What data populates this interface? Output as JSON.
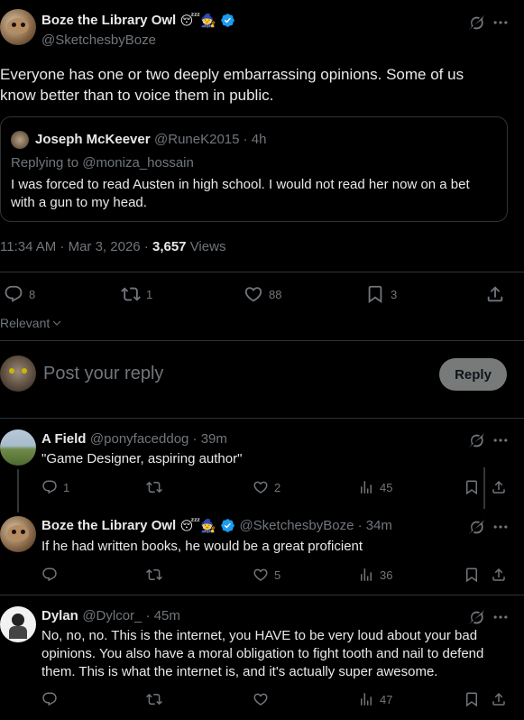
{
  "main_post": {
    "author_name": "Boze the Library Owl",
    "author_emojis": "😴🧙",
    "author_handle": "@SketchesbyBoze",
    "text_line1": "Everyone has one or two deeply embarrassing opinions. Some of us",
    "text_line2": "know better than to voice them in public.",
    "timestamp": "11:34 AM · Mar 3, 2026 · ",
    "views_count": "3,657",
    "views_label": " Views",
    "replies": "8",
    "reposts": "1",
    "likes": "88",
    "bookmarks": "3"
  },
  "quoted_post": {
    "author_name": "Joseph McKeever",
    "author_handle": "@RuneK2015 · 4h",
    "replying_to": "Replying to @moniza_hossain",
    "text_line1": "I was forced to read Austen in high school. I would not read her now on a bet",
    "text_line2": "with a gun to my head."
  },
  "sort_label": "Relevant",
  "reply_box": {
    "placeholder": "Post your reply",
    "button_label": "Reply"
  },
  "replies": [
    {
      "author_name": "A Field",
      "author_handle": "@ponyfaceddog · 39m",
      "text": "\"Game Designer, aspiring author\"",
      "replies": "1",
      "reposts": "",
      "likes": "2",
      "views": "45"
    },
    {
      "author_name": "Boze the Library Owl",
      "author_emojis": "😴🧙",
      "author_handle": "@SketchesbyBoze · 34m",
      "text": "If he had written books, he would be a great proficient",
      "replies": "",
      "reposts": "",
      "likes": "5",
      "views": "36"
    },
    {
      "author_name": "Dylan",
      "author_handle": "@Dylcor_ · 45m",
      "text_line1": "No, no, no. This is the internet, you HAVE to be very loud about your bad",
      "text_line2": "opinions. You also have a moral obligation to fight tooth and nail to defend",
      "text_line3": "them. This is what the internet is, and it's actually super awesome.",
      "replies": "",
      "reposts": "",
      "likes": "",
      "views": "47"
    }
  ],
  "colors": {
    "background": "#000000",
    "text": "#e7e9ea",
    "muted": "#71767b",
    "border": "#2f3336",
    "verified": "#1d9bf0"
  }
}
